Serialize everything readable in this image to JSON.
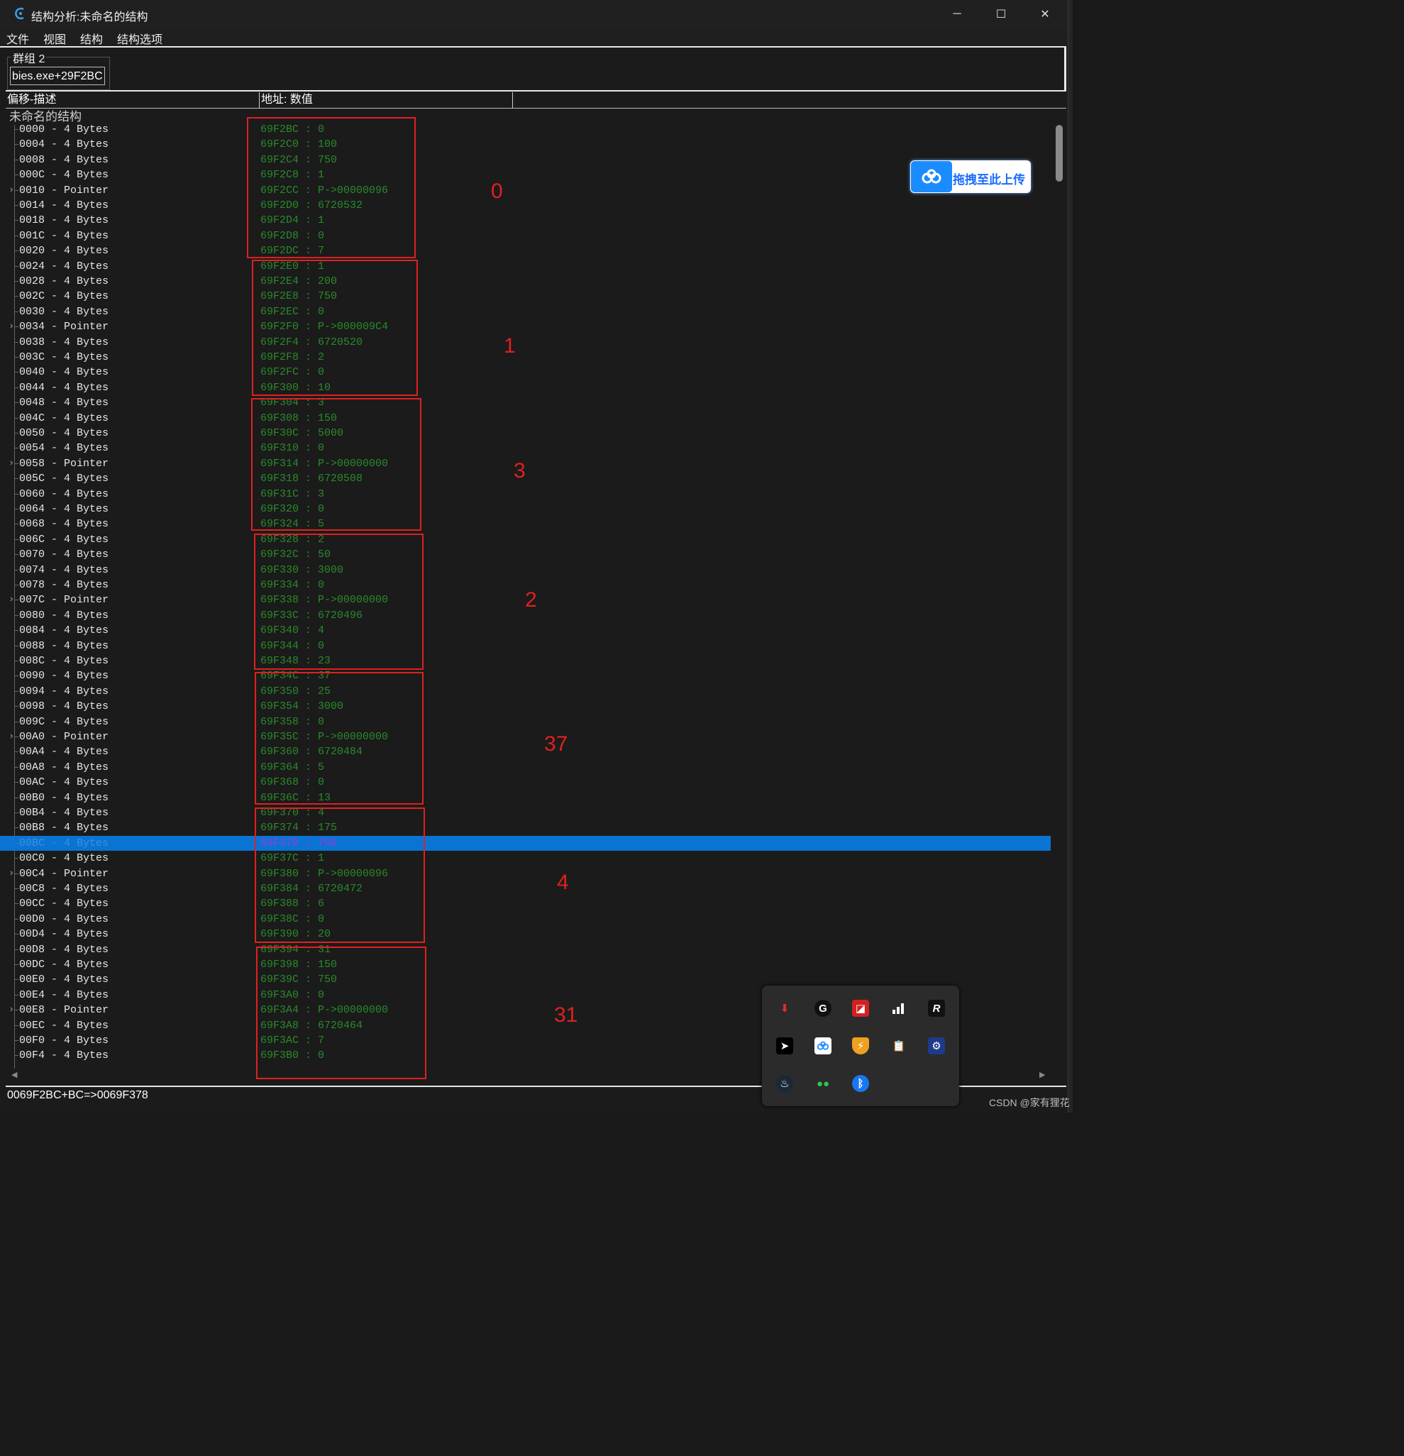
{
  "window": {
    "title": "结构分析:未命名的结构",
    "controls": {
      "minimize": "─",
      "maximize": "☐",
      "close": "✕"
    }
  },
  "menu": [
    "文件",
    "视图",
    "结构",
    "结构选项"
  ],
  "group": {
    "label": "群组 2",
    "address": "bies.exe+29F2BC"
  },
  "columns": {
    "offset_desc": "偏移-描述",
    "address_value": "地址: 数值"
  },
  "structure_name": "未命名的结构",
  "rows": [
    {
      "off": "0000 - 4 Bytes",
      "val": "69F2BC : 0"
    },
    {
      "off": "0004 - 4 Bytes",
      "val": "69F2C0 : 100"
    },
    {
      "off": "0008 - 4 Bytes",
      "val": "69F2C4 : 750"
    },
    {
      "off": "000C - 4 Bytes",
      "val": "69F2C8 : 1"
    },
    {
      "off": "0010 - Pointer",
      "val": "69F2CC : P->00000096",
      "ptr": true
    },
    {
      "off": "0014 - 4 Bytes",
      "val": "69F2D0 : 6720532"
    },
    {
      "off": "0018 - 4 Bytes",
      "val": "69F2D4 : 1"
    },
    {
      "off": "001C - 4 Bytes",
      "val": "69F2D8 : 0"
    },
    {
      "off": "0020 - 4 Bytes",
      "val": "69F2DC : 7"
    },
    {
      "off": "0024 - 4 Bytes",
      "val": "69F2E0 : 1"
    },
    {
      "off": "0028 - 4 Bytes",
      "val": "69F2E4 : 200"
    },
    {
      "off": "002C - 4 Bytes",
      "val": "69F2E8 : 750"
    },
    {
      "off": "0030 - 4 Bytes",
      "val": "69F2EC : 0"
    },
    {
      "off": "0034 - Pointer",
      "val": "69F2F0 : P->000009C4",
      "ptr": true
    },
    {
      "off": "0038 - 4 Bytes",
      "val": "69F2F4 : 6720520"
    },
    {
      "off": "003C - 4 Bytes",
      "val": "69F2F8 : 2"
    },
    {
      "off": "0040 - 4 Bytes",
      "val": "69F2FC : 0"
    },
    {
      "off": "0044 - 4 Bytes",
      "val": "69F300 : 10"
    },
    {
      "off": "0048 - 4 Bytes",
      "val": "69F304 : 3"
    },
    {
      "off": "004C - 4 Bytes",
      "val": "69F308 : 150"
    },
    {
      "off": "0050 - 4 Bytes",
      "val": "69F30C : 5000"
    },
    {
      "off": "0054 - 4 Bytes",
      "val": "69F310 : 0"
    },
    {
      "off": "0058 - Pointer",
      "val": "69F314 : P->00000000",
      "ptr": true
    },
    {
      "off": "005C - 4 Bytes",
      "val": "69F318 : 6720508"
    },
    {
      "off": "0060 - 4 Bytes",
      "val": "69F31C : 3"
    },
    {
      "off": "0064 - 4 Bytes",
      "val": "69F320 : 0"
    },
    {
      "off": "0068 - 4 Bytes",
      "val": "69F324 : 5"
    },
    {
      "off": "006C - 4 Bytes",
      "val": "69F328 : 2"
    },
    {
      "off": "0070 - 4 Bytes",
      "val": "69F32C : 50"
    },
    {
      "off": "0074 - 4 Bytes",
      "val": "69F330 : 3000"
    },
    {
      "off": "0078 - 4 Bytes",
      "val": "69F334 : 0"
    },
    {
      "off": "007C - Pointer",
      "val": "69F338 : P->00000000",
      "ptr": true
    },
    {
      "off": "0080 - 4 Bytes",
      "val": "69F33C : 6720496"
    },
    {
      "off": "0084 - 4 Bytes",
      "val": "69F340 : 4"
    },
    {
      "off": "0088 - 4 Bytes",
      "val": "69F344 : 0"
    },
    {
      "off": "008C - 4 Bytes",
      "val": "69F348 : 23"
    },
    {
      "off": "0090 - 4 Bytes",
      "val": "69F34C : 37"
    },
    {
      "off": "0094 - 4 Bytes",
      "val": "69F350 : 25"
    },
    {
      "off": "0098 - 4 Bytes",
      "val": "69F354 : 3000"
    },
    {
      "off": "009C - 4 Bytes",
      "val": "69F358 : 0"
    },
    {
      "off": "00A0 - Pointer",
      "val": "69F35C : P->00000000",
      "ptr": true
    },
    {
      "off": "00A4 - 4 Bytes",
      "val": "69F360 : 6720484"
    },
    {
      "off": "00A8 - 4 Bytes",
      "val": "69F364 : 5"
    },
    {
      "off": "00AC - 4 Bytes",
      "val": "69F368 : 0"
    },
    {
      "off": "00B0 - 4 Bytes",
      "val": "69F36C : 13"
    },
    {
      "off": "00B4 - 4 Bytes",
      "val": "69F370 : 4"
    },
    {
      "off": "00B8 - 4 Bytes",
      "val": "69F374 : 175"
    },
    {
      "off": "00BC - 4 Bytes",
      "val": "69F378 : 750",
      "selected": true
    },
    {
      "off": "00C0 - 4 Bytes",
      "val": "69F37C : 1"
    },
    {
      "off": "00C4 - Pointer",
      "val": "69F380 : P->00000096",
      "ptr": true
    },
    {
      "off": "00C8 - 4 Bytes",
      "val": "69F384 : 6720472"
    },
    {
      "off": "00CC - 4 Bytes",
      "val": "69F388 : 6"
    },
    {
      "off": "00D0 - 4 Bytes",
      "val": "69F38C : 0"
    },
    {
      "off": "00D4 - 4 Bytes",
      "val": "69F390 : 20"
    },
    {
      "off": "00D8 - 4 Bytes",
      "val": "69F394 : 31"
    },
    {
      "off": "00DC - 4 Bytes",
      "val": "69F398 : 150"
    },
    {
      "off": "00E0 - 4 Bytes",
      "val": "69F39C : 750"
    },
    {
      "off": "00E4 - 4 Bytes",
      "val": "69F3A0 : 0"
    },
    {
      "off": "00E8 - Pointer",
      "val": "69F3A4 : P->00000000",
      "ptr": true
    },
    {
      "off": "00EC - 4 Bytes",
      "val": "69F3A8 : 6720464"
    },
    {
      "off": "00F0 - 4 Bytes",
      "val": "69F3AC : 7"
    },
    {
      "off": "00F4 - 4 Bytes",
      "val": "69F3B0 : 0"
    }
  ],
  "annotations": [
    "0",
    "1",
    "3",
    "2",
    "37",
    "4",
    "31"
  ],
  "status": "0069F2BC+BC=>0069F378",
  "upload_button": "拖拽至此上传",
  "tray_icons": [
    "download-icon",
    "logitech-g-icon",
    "amd-icon",
    "bar-chart-icon",
    "r-icon",
    "cursor-app-icon",
    "baidu-netdisk-icon",
    "shield-icon",
    "clipboard-icon",
    "network-app-icon",
    "steam-icon",
    "wechat-icon",
    "bluetooth-icon"
  ],
  "watermark": "CSDN @家有狸花"
}
